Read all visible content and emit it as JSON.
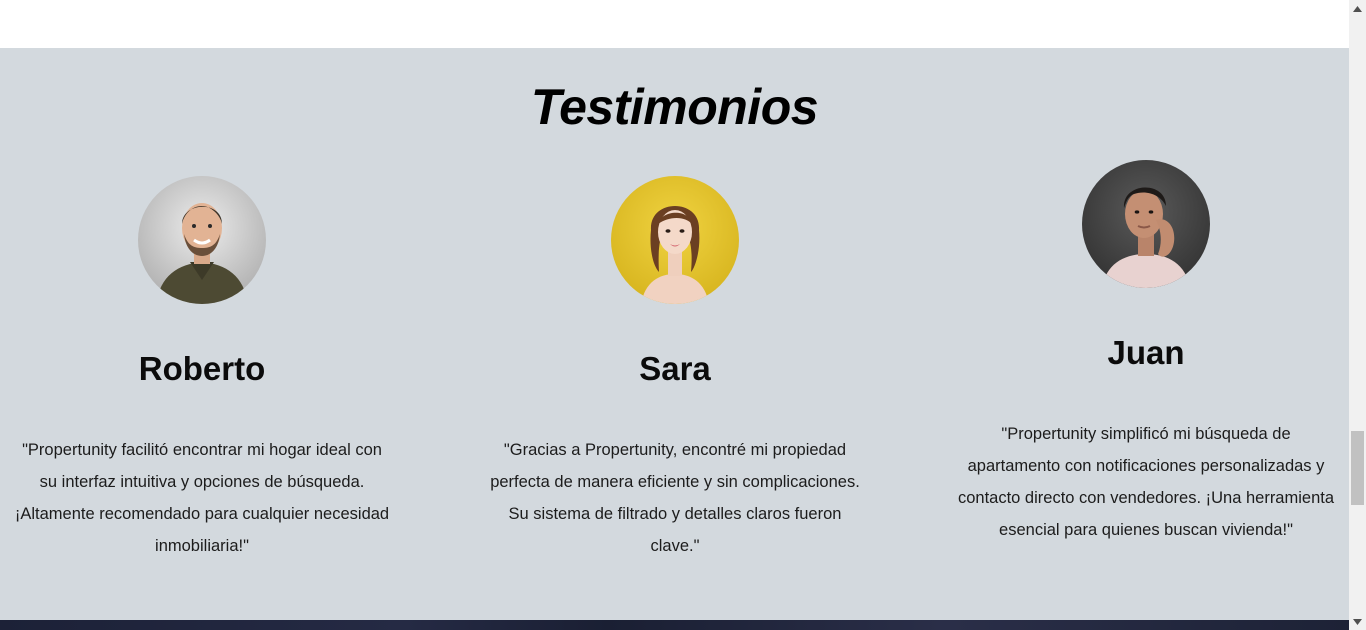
{
  "section": {
    "title": "Testimonios"
  },
  "testimonials": [
    {
      "name": "Roberto",
      "quote": "\"Propertunity facilitó encontrar mi hogar ideal con su interfaz intuitiva y opciones de búsqueda. ¡Altamente recomendado para cualquier necesidad inmobiliaria!\""
    },
    {
      "name": "Sara",
      "quote": "\"Gracias a Propertunity, encontré mi propiedad perfecta de manera eficiente y sin complicaciones. Su sistema de filtrado y detalles claros fueron clave.\""
    },
    {
      "name": "Juan",
      "quote": "\"Propertunity simplificó mi búsqueda de apartamento con notificaciones personalizadas y contacto directo con vendedores. ¡Una herramienta esencial para quienes buscan vivienda!\""
    }
  ],
  "icons": {
    "scroll_up": "scroll-up-arrow-icon",
    "scroll_down": "scroll-down-arrow-icon"
  },
  "colors": {
    "section_background": "#d3d9de",
    "page_background": "#ffffff",
    "footer_dark": "#1c2137"
  }
}
